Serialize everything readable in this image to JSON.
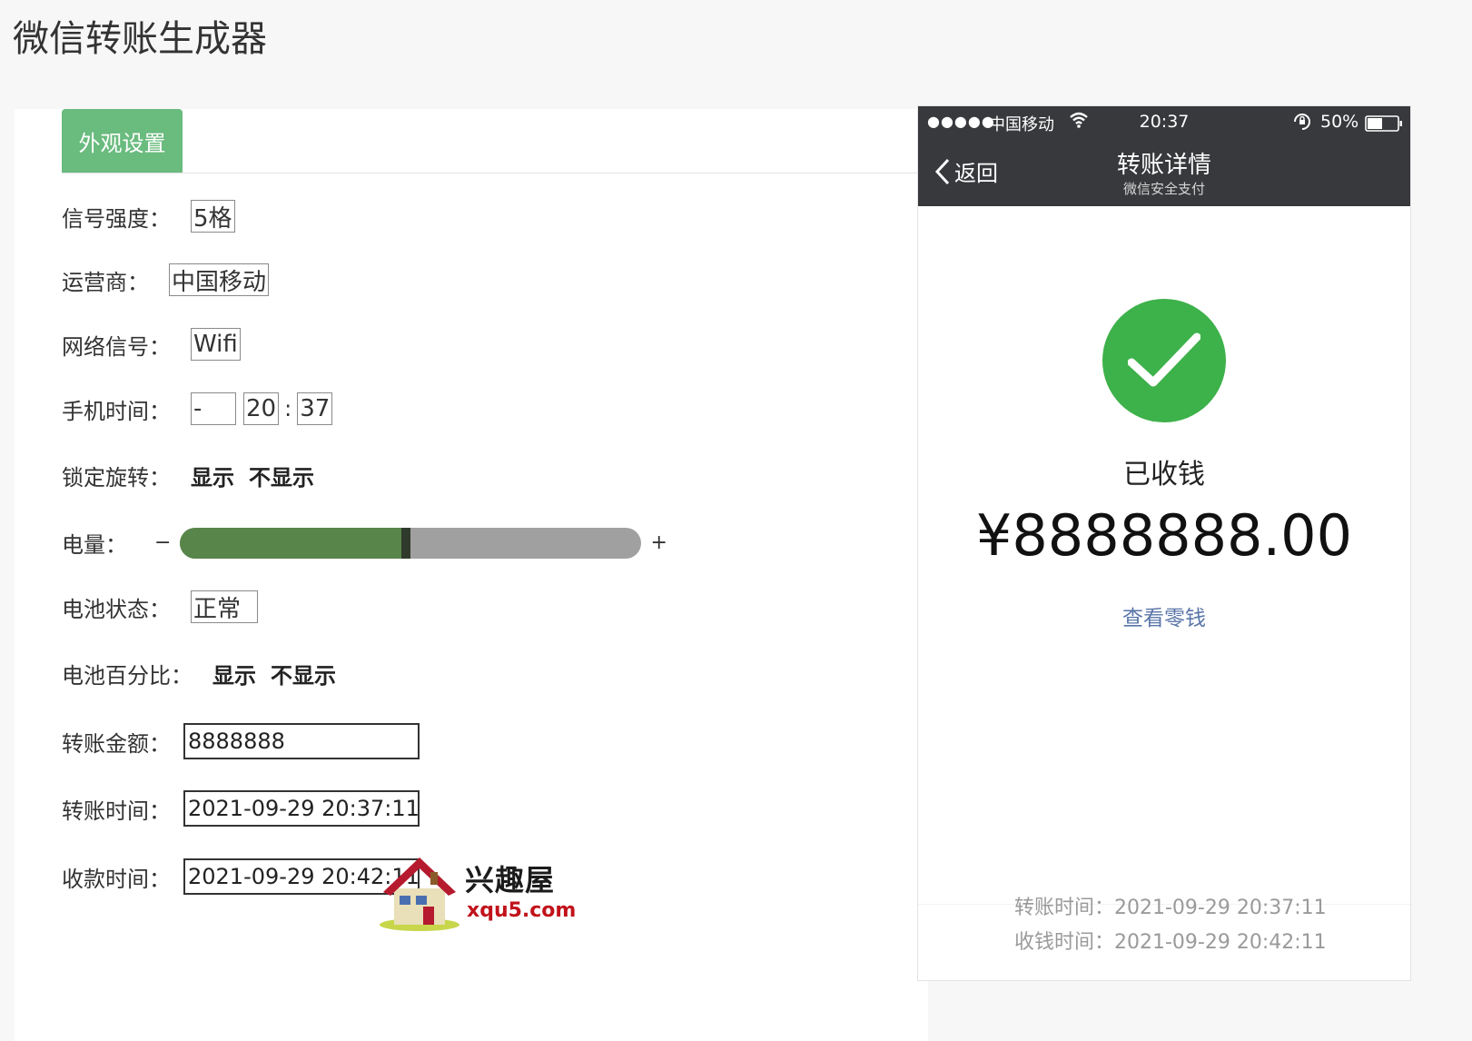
{
  "page": {
    "title": "微信转账生成器"
  },
  "tabs": {
    "active": "外观设置"
  },
  "form": {
    "signal": {
      "label": "信号强度：",
      "value": "5格"
    },
    "carrier": {
      "label": "运营商：",
      "value": "中国移动"
    },
    "network": {
      "label": "网络信号：",
      "value": "Wifi"
    },
    "phone_time": {
      "label": "手机时间：",
      "ampm": "-",
      "hour": "20",
      "colon": ":",
      "minute": "37"
    },
    "lock_rotation": {
      "label": "锁定旋转：",
      "show": "显示",
      "hide": "不显示"
    },
    "battery": {
      "label": "电量：",
      "minus": "−",
      "plus": "+",
      "level_percent": 50
    },
    "battery_status": {
      "label": "电池状态：",
      "value": "正常"
    },
    "battery_percent_toggle": {
      "label": "电池百分比：",
      "show": "显示",
      "hide": "不显示"
    },
    "amount": {
      "label": "转账金额：",
      "value": "8888888"
    },
    "transfer_time": {
      "label": "转账时间：",
      "value": "2021-09-29 20:37:11"
    },
    "receive_time": {
      "label": "收款时间：",
      "value": "2021-09-29 20:42:11"
    }
  },
  "watermark": {
    "title": "兴趣屋",
    "url": "xqu5.com"
  },
  "phone": {
    "status_bar": {
      "signal_dots": "●●●●●",
      "carrier": "中国移动",
      "time": "20:37",
      "battery_text": "50%"
    },
    "nav": {
      "back": "返回",
      "title": "转账详情",
      "subtitle": "微信安全支付"
    },
    "status_text": "已收钱",
    "amount": "¥8888888.00",
    "link": "查看零钱",
    "footer": {
      "transfer_time": "转账时间：2021-09-29 20:37:11",
      "receive_time": "收钱时间：2021-09-29 20:42:11"
    }
  },
  "colors": {
    "tab_active": "#6abb7e",
    "slider_fill": "#58864a",
    "check_green": "#3db14a",
    "link_blue": "#5a75a8",
    "phone_bar": "#37393c"
  },
  "icons": [
    "wifi-icon",
    "rotation-lock-icon",
    "battery-icon",
    "back-chevron-icon",
    "check-icon",
    "house-logo-icon"
  ]
}
